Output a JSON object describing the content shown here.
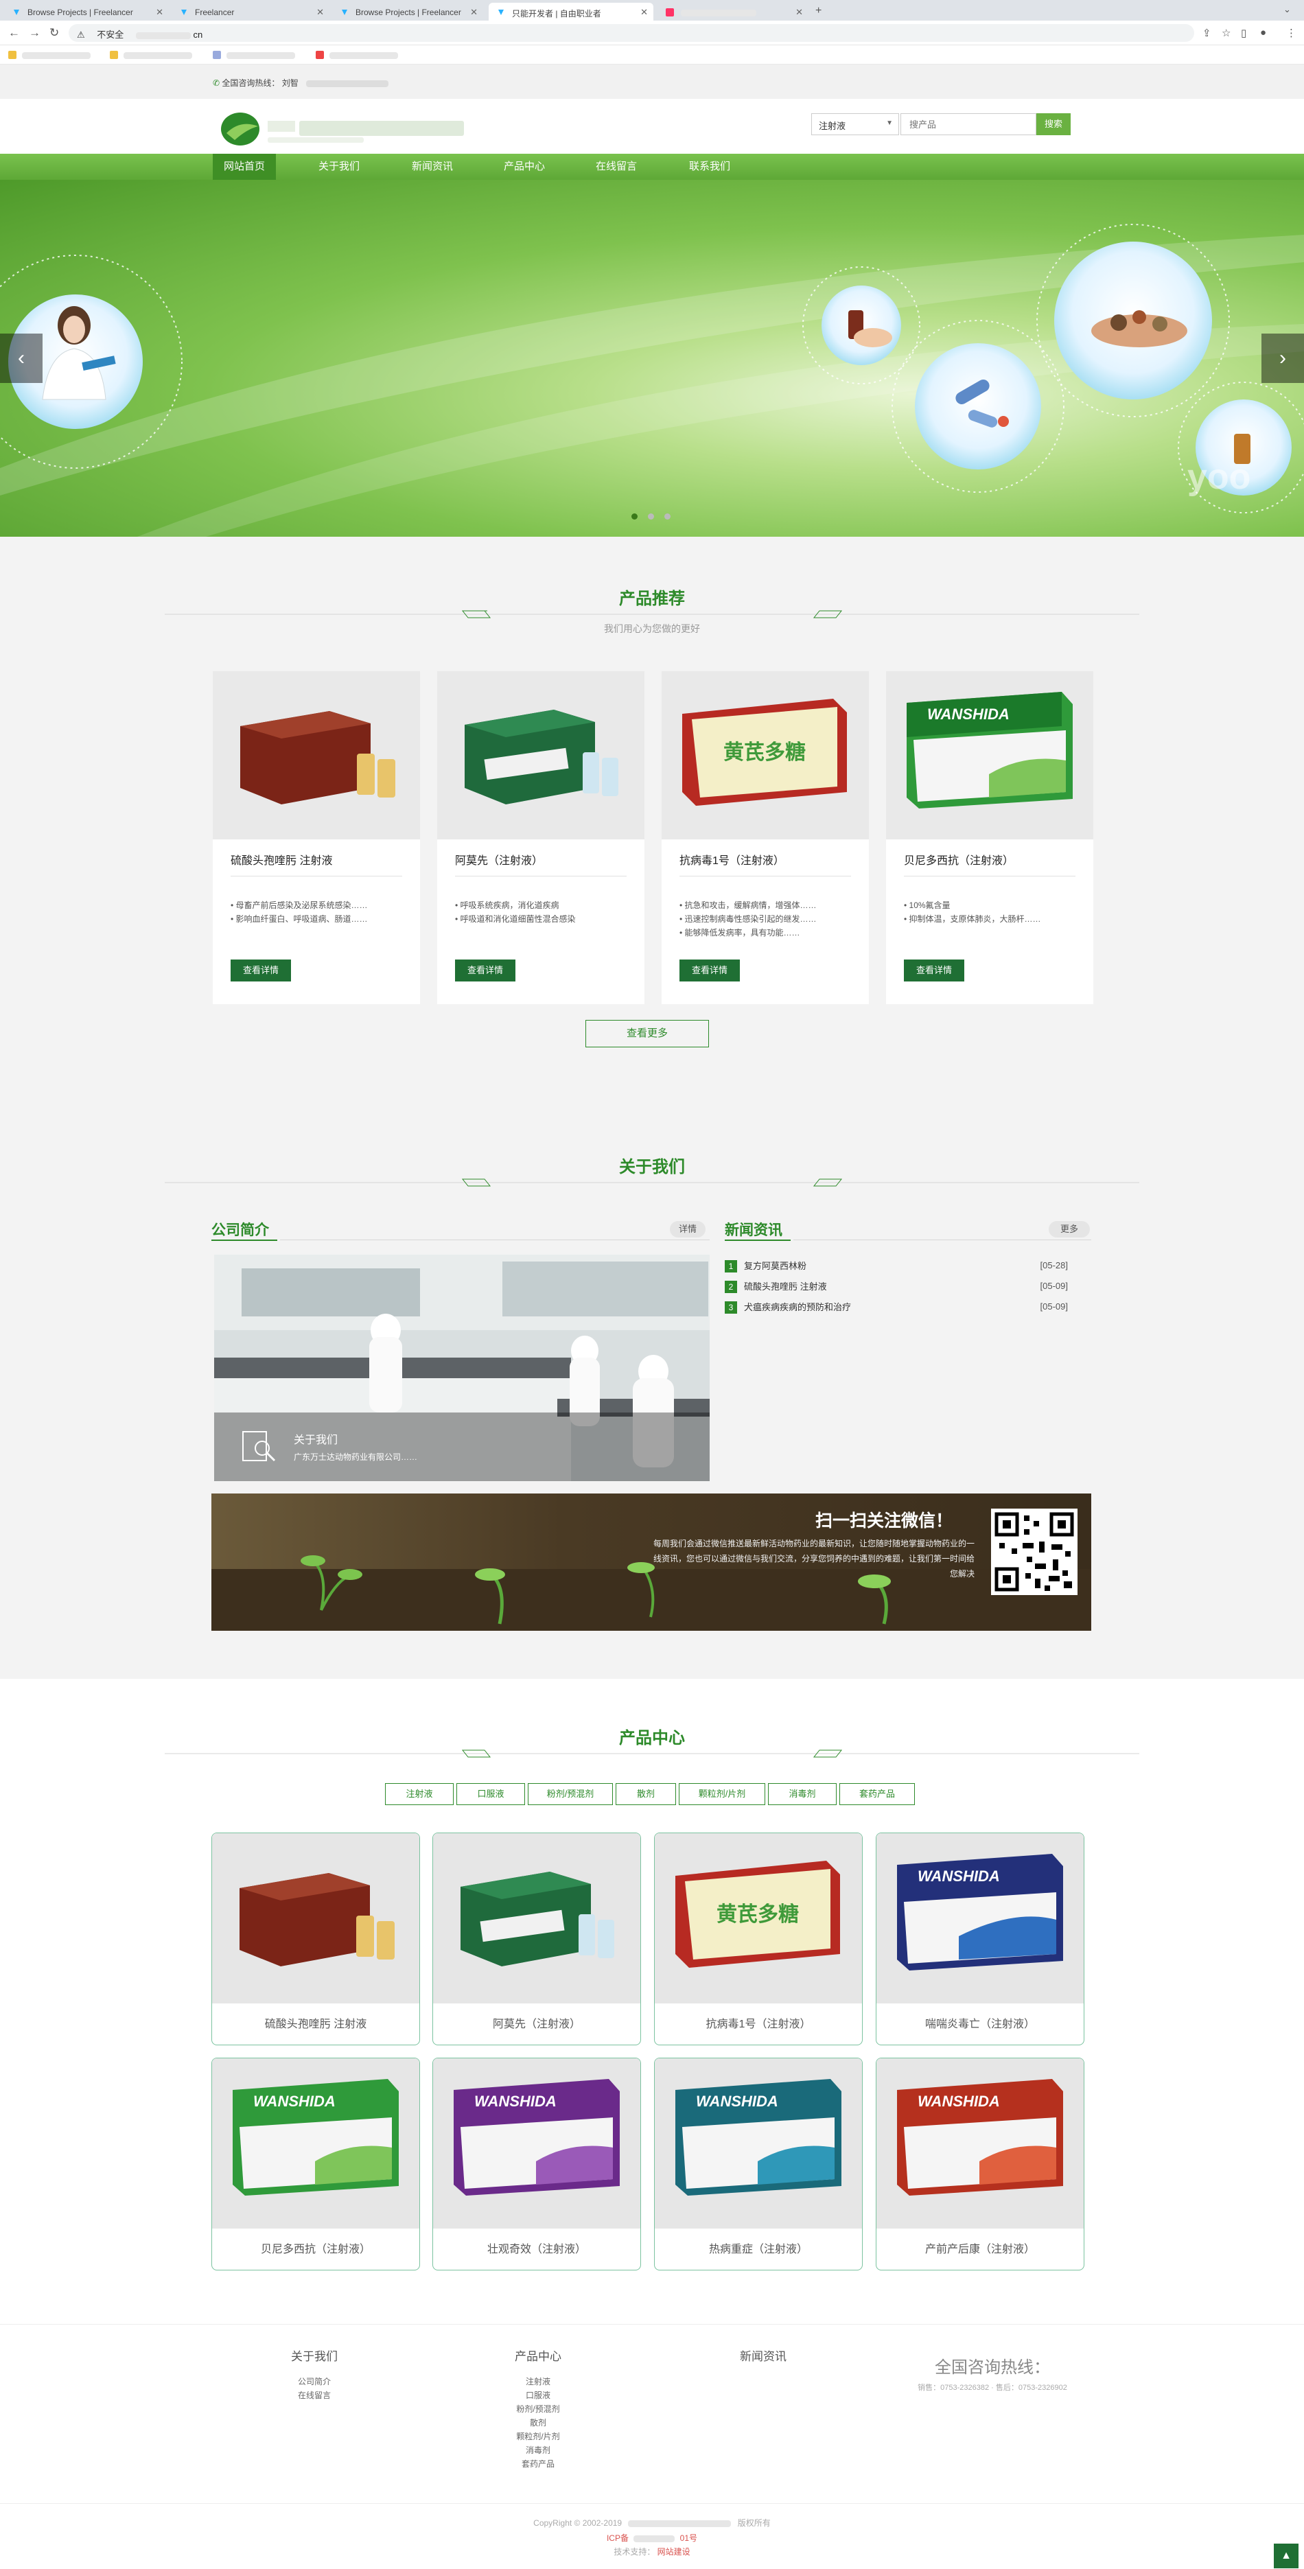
{
  "browser": {
    "tabs": [
      {
        "label": "Browse Projects | Freelancer",
        "active": false
      },
      {
        "label": "Freelancer",
        "active": false
      },
      {
        "label": "Browse Projects | Freelancer",
        "active": false
      },
      {
        "label": "只能开发者 | 自由职业者",
        "active": true
      },
      {
        "label": "",
        "active": false
      }
    ],
    "security_label": "不安全",
    "url": "cn"
  },
  "topbar": {
    "hotline_label": "全国咨询热线：",
    "hotline_prefix": "刘智"
  },
  "search": {
    "select_value": "注射液",
    "placeholder": "搜产品",
    "button": "搜索"
  },
  "nav": [
    {
      "label": "网站首页",
      "current": true
    },
    {
      "label": "关于我们",
      "current": false
    },
    {
      "label": "新闻资讯",
      "current": false
    },
    {
      "label": "产品中心",
      "current": false
    },
    {
      "label": "在线留言",
      "current": false
    },
    {
      "label": "联系我们",
      "current": false
    }
  ],
  "banner": {
    "watermark": "yoo"
  },
  "recommend": {
    "title": "产品推荐",
    "subtitle": "我们用心为您做的更好",
    "cards": [
      {
        "name": "硫酸头孢喹肟 注射液",
        "bullets": [
          "• 母畜产前后感染及泌尿系统感染……",
          "• 影响血纤蛋白、呼吸道病、肠道……"
        ],
        "button": "查看详情"
      },
      {
        "name": "阿莫先（注射液）",
        "bullets": [
          "• 呼吸系统疾病，消化道疾病",
          "• 呼吸道和消化道细菌性混合感染"
        ],
        "button": "查看详情"
      },
      {
        "name": "抗病毒1号（注射液）",
        "bullets": [
          "• 抗急和攻击，缓解病情，增强体……",
          "• 迅速控制病毒性感染引起的继发……",
          "• 能够降低发病率，具有功能……"
        ],
        "button": "查看详情"
      },
      {
        "name": "贝尼多西抗（注射液）",
        "bullets": [
          "• 10%氟含量",
          "• 抑制体温，支原体肺炎，大肠杆……"
        ],
        "button": "查看详情"
      }
    ],
    "more": "查看更多"
  },
  "about": {
    "title": "关于我们",
    "intro_heading": "公司简介",
    "intro_more": "详情",
    "intro_caption_title": "关于我们",
    "intro_caption_text": "广东万士达动物药业有限公司……",
    "news_heading": "新闻资讯",
    "news_more": "更多",
    "news": [
      {
        "n": "1",
        "title": "复方阿莫西林粉",
        "date": "[05-28]"
      },
      {
        "n": "2",
        "title": "硫酸头孢喹肟 注射液",
        "date": "[05-09]"
      },
      {
        "n": "3",
        "title": "犬瘟疾病疾病的预防和治疗",
        "date": "[05-09]"
      }
    ],
    "wechat_title": "扫一扫关注微信！",
    "wechat_text": "每周我们会通过微信推送最新鲜活动物药业的最新知识，让您随时随地掌握动物药业的一线资讯，您也可以通过微信与我们交流，分享您饲养的中遇到的难题，让我们第一时间给您解决"
  },
  "products": {
    "title": "产品中心",
    "categories": [
      "注射液",
      "口服液",
      "粉剂/预混剂",
      "散剂",
      "颗粒剂/片剂",
      "消毒剂",
      "套药产品"
    ],
    "items": [
      {
        "name": "硫酸头孢喹肟 注射液"
      },
      {
        "name": "阿莫先（注射液）"
      },
      {
        "name": "抗病毒1号（注射液）"
      },
      {
        "name": "喘喘炎毒亡（注射液）"
      },
      {
        "name": "贝尼多西抗（注射液）"
      },
      {
        "name": "壮观奇效（注射液）"
      },
      {
        "name": "热病重症（注射液）"
      },
      {
        "name": "产前产后康（注射液）"
      }
    ]
  },
  "footer": {
    "cols": [
      {
        "heading": "关于我们",
        "links": [
          "公司简介",
          "在线留言"
        ]
      },
      {
        "heading": "产品中心",
        "links": [
          "注射液",
          "口服液",
          "粉剂/预混剂",
          "散剂",
          "颗粒剂/片剂",
          "消毒剂",
          "套药产品"
        ]
      },
      {
        "heading": "新闻资讯",
        "links": []
      }
    ],
    "hotline_title": "全国咨询热线：",
    "hotline_numbers": "销售：0753-2326382  · 售后：0753-2326902",
    "copyright": "CopyRight © 2002-2019",
    "rights": "版权所有",
    "icp": "ICP备",
    "icp_suffix": "01号",
    "tech_label": "技术支持：",
    "tech_value": "网站建设"
  }
}
